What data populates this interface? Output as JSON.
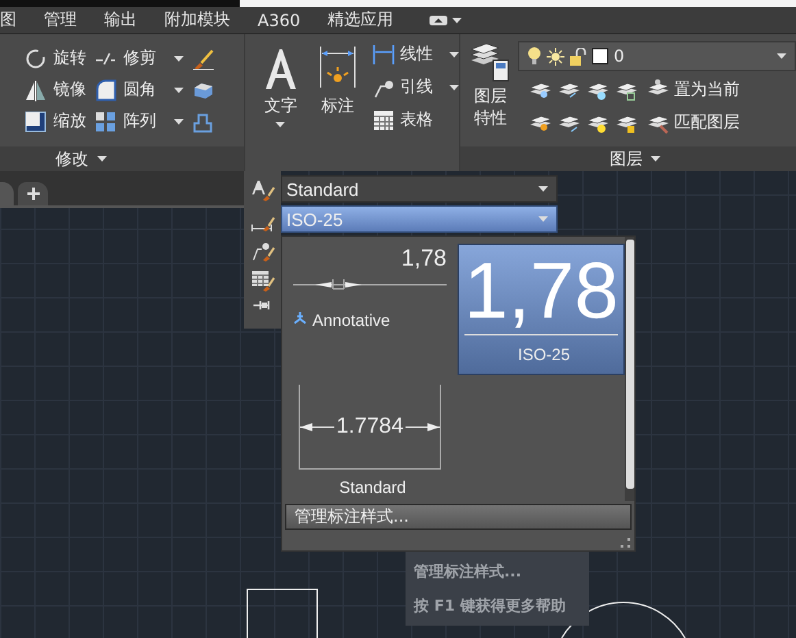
{
  "ribbon_tabs": [
    {
      "label": "图"
    },
    {
      "label": "管理"
    },
    {
      "label": "输出"
    },
    {
      "label": "附加模块"
    },
    {
      "label": "A360"
    },
    {
      "label": "精选应用"
    }
  ],
  "modify_panel": {
    "title": "修改",
    "tools": [
      {
        "label": "旋转",
        "has_menu": false,
        "kind": "rotate"
      },
      {
        "label": "镜像",
        "has_menu": false,
        "kind": "mirror"
      },
      {
        "label": "缩放",
        "has_menu": false,
        "kind": "scale"
      },
      {
        "label": "修剪",
        "has_menu": true,
        "kind": "trim"
      },
      {
        "label": "圆角",
        "has_menu": true,
        "kind": "fillet"
      },
      {
        "label": "阵列",
        "has_menu": true,
        "kind": "array"
      }
    ]
  },
  "annotation_panel": {
    "big_tools": [
      {
        "label": "文字",
        "has_menu": true,
        "kind": "text"
      },
      {
        "label": "标注",
        "has_menu": false,
        "kind": "dimension"
      }
    ],
    "tools": [
      {
        "label": "线性",
        "has_menu": true,
        "kind": "linear"
      },
      {
        "label": "引线",
        "has_menu": true,
        "kind": "leader"
      },
      {
        "label": "表格",
        "has_menu": false,
        "kind": "table"
      }
    ]
  },
  "layers_panel": {
    "title": "图层",
    "properties_button": "图层特性",
    "layer_combo": {
      "value": "0"
    },
    "tools": [
      {
        "label": "置为当前"
      },
      {
        "label": "匹配图层"
      }
    ]
  },
  "styles_flyout": {
    "text_style": {
      "value": "Standard",
      "selected": false
    },
    "dimension_style": {
      "value": "ISO-25",
      "selected": true
    },
    "gallery": [
      {
        "name": "Annotative",
        "preview": "1,78",
        "kind": "dimension-small",
        "annotative": true,
        "selected": false
      },
      {
        "name": "ISO-25",
        "preview": "1,78",
        "kind": "text-large",
        "annotative": false,
        "selected": true
      },
      {
        "name": "Standard",
        "preview": "1.7784",
        "kind": "dimension-boxed",
        "annotative": false,
        "selected": false
      }
    ],
    "manage_button": "管理标注样式..."
  },
  "tooltip": {
    "title": "管理标注样式...",
    "help": "按 F1 键获得更多帮助"
  }
}
